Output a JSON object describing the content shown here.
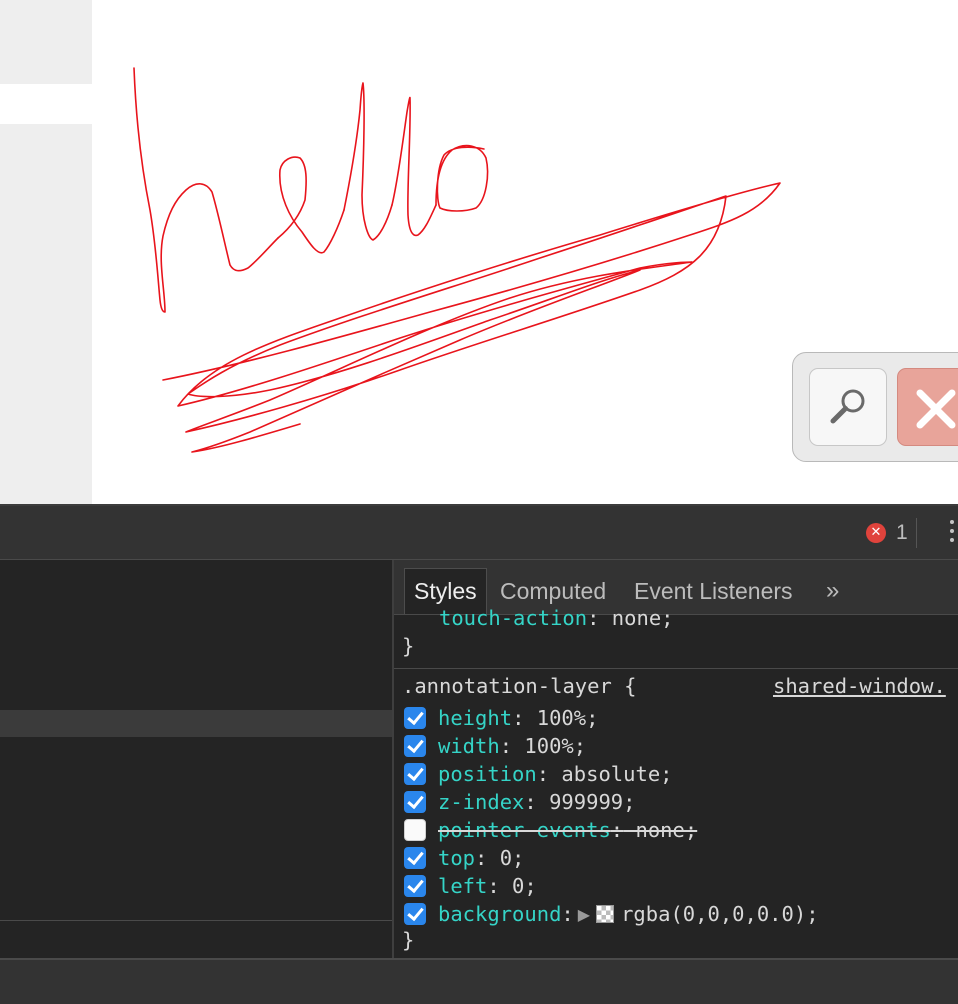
{
  "page": {
    "annotation_stroke_color": "#e8141c",
    "search_button_icon": "magnifier-icon",
    "close_button_icon": "close-x-icon"
  },
  "devtools": {
    "error_count": "1",
    "error_icon": "✕",
    "more_icon": "vertical-ellipsis-icon"
  },
  "styles_tabs": {
    "styles": "Styles",
    "computed": "Computed",
    "event_listeners": "Event Listeners",
    "more": "»"
  },
  "styles": {
    "cutoff_prop": "touch-action",
    "cutoff_value": " none;",
    "cutoff_close": "}",
    "selector": ".annotation-layer {",
    "source": "shared-window.",
    "close": "}",
    "declarations": [
      {
        "prop": "height",
        "value": " 100%;",
        "checked": true
      },
      {
        "prop": "width",
        "value": " 100%;",
        "checked": true
      },
      {
        "prop": "position",
        "value": " absolute;",
        "checked": true
      },
      {
        "prop": "z-index",
        "value": " 999999;",
        "checked": true
      },
      {
        "prop": "pointer-events",
        "value": " none;",
        "checked": false
      },
      {
        "prop": "top",
        "value": " 0;",
        "checked": true
      },
      {
        "prop": "left",
        "value": " 0;",
        "checked": true
      },
      {
        "prop": "background",
        "value": "rgba(0,0,0,0.0);",
        "checked": true
      }
    ]
  },
  "colors": {
    "accent_checkbox": "#2a86ec",
    "property_name": "#35d4c7",
    "error_red": "#e0433c"
  }
}
